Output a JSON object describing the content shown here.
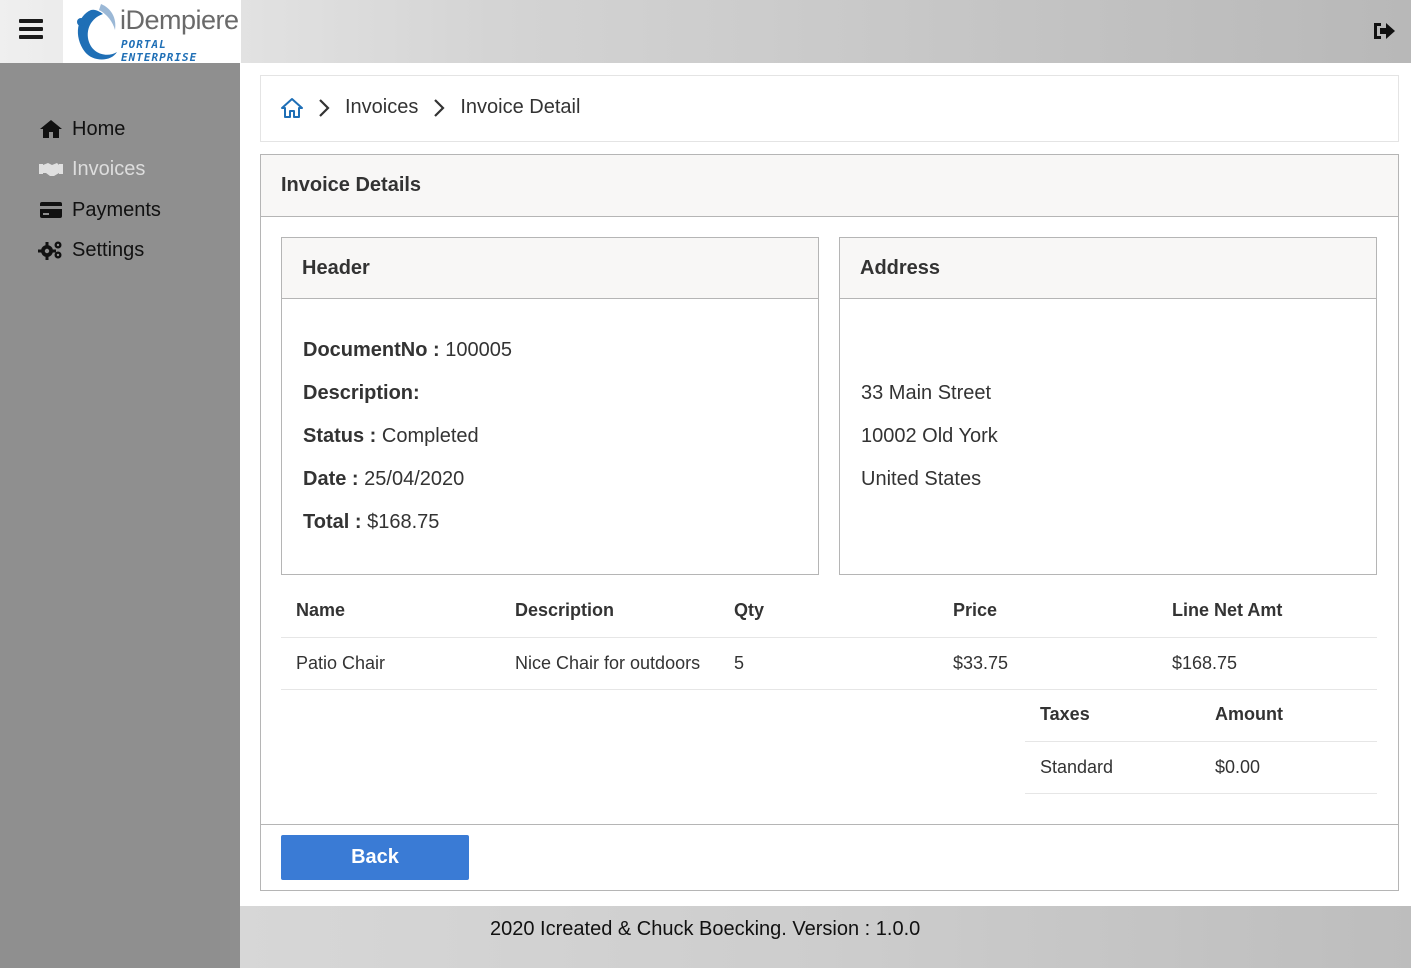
{
  "topbar": {
    "logo_title": "iDempiere",
    "logo_subtitle": "PORTAL ENTERPRISE",
    "menu_icon": "hamburger-icon",
    "logout_icon": "sign-out-icon"
  },
  "sidebar": {
    "items": [
      {
        "label": "Home",
        "icon": "home-icon"
      },
      {
        "label": "Invoices",
        "icon": "handshake-icon"
      },
      {
        "label": "Payments",
        "icon": "credit-card-icon"
      },
      {
        "label": "Settings",
        "icon": "cogs-icon"
      }
    ]
  },
  "breadcrumb": {
    "home_icon": "home-outline-icon",
    "items": [
      "Invoices",
      "Invoice Detail"
    ]
  },
  "main": {
    "title": "Invoice Details",
    "header_card": {
      "title": "Header",
      "fields": [
        {
          "label": "DocumentNo :",
          "value": "100005"
        },
        {
          "label": "Description:",
          "value": ""
        },
        {
          "label": "Status :",
          "value": "Completed"
        },
        {
          "label": "Date :",
          "value": "25/04/2020"
        },
        {
          "label": "Total :",
          "value": "$168.75"
        }
      ]
    },
    "address_card": {
      "title": "Address",
      "lines": [
        "33 Main Street",
        "10002 Old York",
        "United States"
      ]
    },
    "lines_table": {
      "columns": [
        "Name",
        "Description",
        "Qty",
        "Price",
        "Line Net Amt"
      ],
      "rows": [
        [
          "Patio Chair",
          "Nice Chair for outdoors",
          "5",
          "$33.75",
          "$168.75"
        ]
      ]
    },
    "tax_table": {
      "columns": [
        "Taxes",
        "Amount"
      ],
      "rows": [
        [
          "Standard",
          "$0.00"
        ]
      ]
    },
    "back_label": "Back"
  },
  "footer": {
    "text": "2020 Icreated & Chuck Boecking. Version : 1.0.0"
  },
  "colors": {
    "accent": "#3a7bd5",
    "sidebar_bg": "#8f8f8f",
    "card_header_bg": "#f8f7f6"
  }
}
